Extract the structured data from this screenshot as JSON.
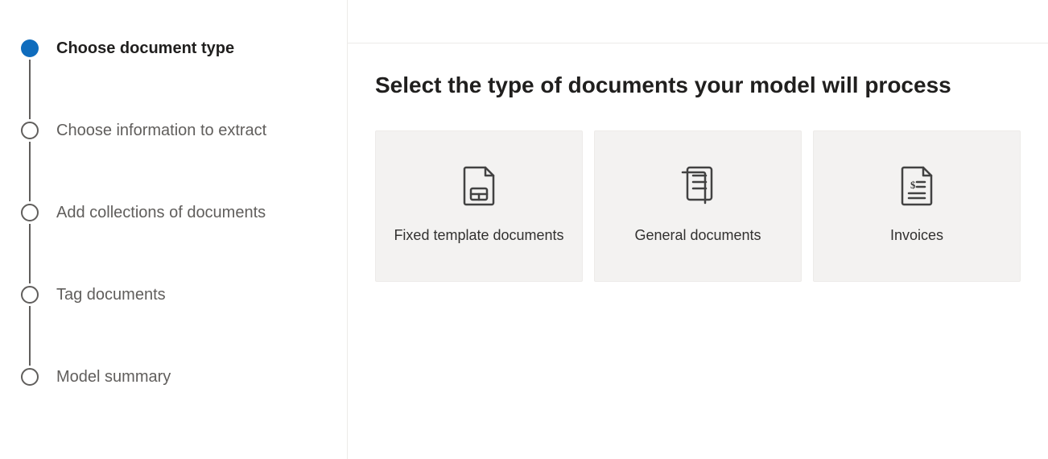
{
  "sidebar": {
    "steps": [
      {
        "label": "Choose document type",
        "active": true
      },
      {
        "label": "Choose information to extract",
        "active": false
      },
      {
        "label": "Add collections of documents",
        "active": false
      },
      {
        "label": "Tag documents",
        "active": false
      },
      {
        "label": "Model summary",
        "active": false
      }
    ]
  },
  "main": {
    "title": "Select the type of documents your model will process",
    "cards": [
      {
        "label": "Fixed template documents"
      },
      {
        "label": "General documents"
      },
      {
        "label": "Invoices"
      }
    ]
  }
}
